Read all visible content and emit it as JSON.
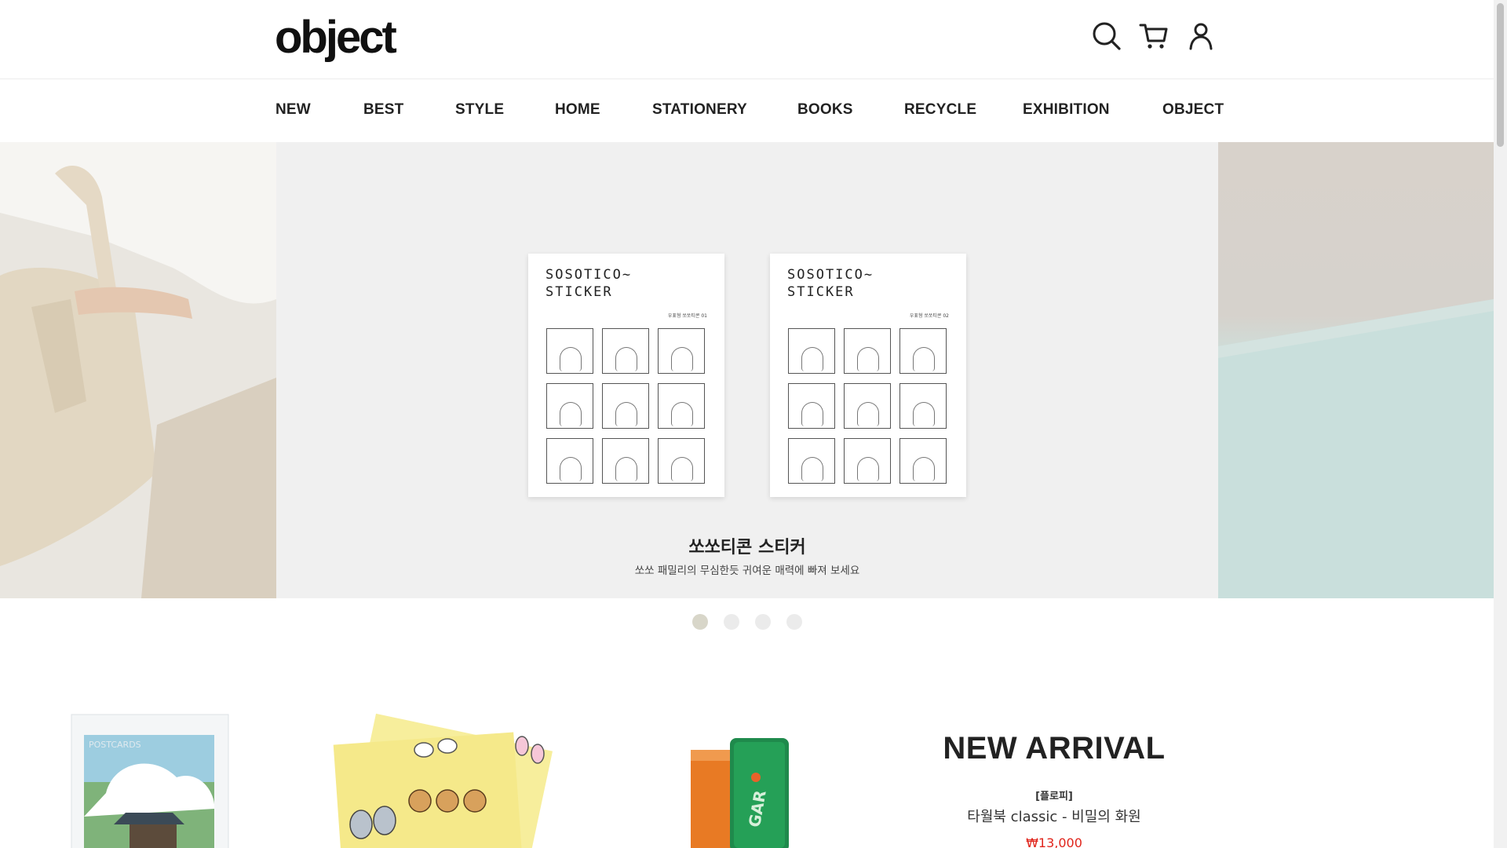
{
  "header": {
    "logo": "object",
    "icons": [
      "search-icon",
      "cart-icon",
      "user-icon"
    ]
  },
  "nav": {
    "items": [
      "NEW",
      "BEST",
      "STYLE",
      "HOME",
      "STATIONERY",
      "BOOKS",
      "RECYCLE",
      "EXHIBITION",
      "OBJECT"
    ]
  },
  "hero": {
    "card1": {
      "title": "SOSOTICO~\nSTICKER",
      "subtitle": "우표형 쏘쏘티콘 01"
    },
    "card2": {
      "title": "SOSOTICO~\nSTICKER",
      "subtitle": "우표형 쏘쏘티콘 02"
    },
    "title": "쏘쏘티콘 스티커",
    "subtitle": "쏘쏘 패밀리의 무심한듯 귀여운 매력에 빠져 보세요",
    "slide_count": 4,
    "active_slide": 1
  },
  "new_arrival": {
    "heading": "NEW ARRIVAL",
    "brand": "[플로피]",
    "name": "타월북 classic - 비밀의 화원",
    "price": "₩13,000"
  },
  "colors": {
    "accent_price": "#e0241b",
    "dot_active": "#d8d6c9",
    "dot_inactive": "#ebebeb",
    "hero_bg": "#f0f0f0"
  }
}
